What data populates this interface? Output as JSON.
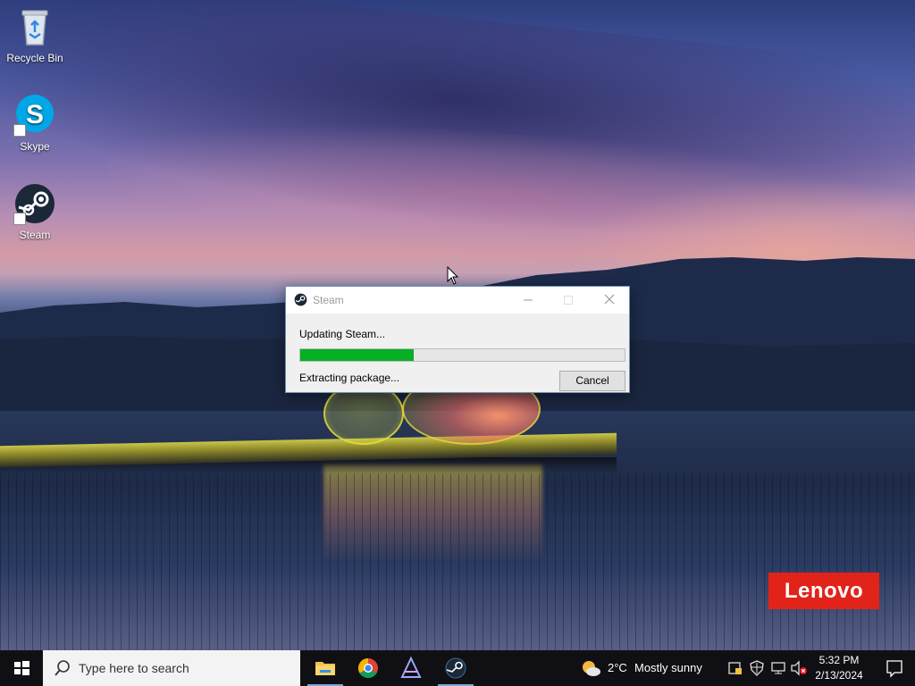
{
  "desktop": {
    "icons": [
      {
        "label": "Recycle Bin"
      },
      {
        "label": "Skype"
      },
      {
        "label": "Steam"
      }
    ],
    "wallpaper_logo": "Lenovo"
  },
  "dialog": {
    "title": "Steam",
    "status": "Updating Steam...",
    "progress_fraction": 0.35,
    "detail": "Extracting package...",
    "cancel_label": "Cancel",
    "colors": {
      "progress": "#06b025"
    }
  },
  "taskbar": {
    "search_placeholder": "Type here to search",
    "pinned_apps": [
      "file-explorer-icon",
      "chrome-icon",
      "app-icon",
      "steam-icon"
    ],
    "weather": {
      "temp": "2°C",
      "condition": "Mostly sunny"
    },
    "clock": {
      "time": "5:32 PM",
      "date": "2/13/2024"
    }
  }
}
